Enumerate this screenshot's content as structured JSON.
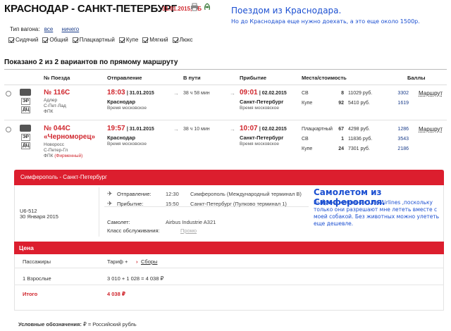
{
  "header": {
    "route_title": "КРАСНОДАР - САНКТ-ПЕТЕРБУРГ",
    "date_label": "31.01.2015, СБ",
    "icons": [
      "print-icon",
      "vk-icon"
    ]
  },
  "annotation1": {
    "title": "Поездом из Краснодара.",
    "subtitle": "Но до Краснодара еще нужно доехать, а это еще около 1500р."
  },
  "filters": {
    "wagon_type_label": "Тип вагона:",
    "all_link": "все",
    "none_link": "ничего",
    "options": [
      "Сидячий",
      "Общий",
      "Плацкартный",
      "Купе",
      "Мягкий",
      "Люкс"
    ]
  },
  "results": {
    "shown_text": "Показано 2 из 2 вариантов по прямому маршруту",
    "columns": [
      "№ Поезда",
      "Отправление",
      "В пути",
      "Прибытие",
      "Места/стоимость",
      "Баллы"
    ],
    "trains": [
      {
        "tag1": "ЭР",
        "tag2": "ДЦ",
        "number": "№ 116С",
        "name": "",
        "route1": "Адлер",
        "route2": "С-Пет-Лад",
        "carrier": "ФПК",
        "carrier_extra": "",
        "dep_time": "18:03",
        "dep_date": "| 31.01.2015",
        "dep_city": "Краснодар",
        "dep_tz": "Время московское",
        "duration": "38 ч 58 мин",
        "arr_time": "09:01",
        "arr_date": "| 02.02.2015",
        "arr_city": "Санкт-Петербург",
        "arr_tz": "Время московское",
        "seats": [
          {
            "class": "СВ",
            "count": "8",
            "price": "11029 руб.",
            "points": "3302"
          },
          {
            "class": "Купе",
            "count": "92",
            "price": "5410 руб.",
            "points": "1619"
          }
        ],
        "route_link": "Маршрут"
      },
      {
        "tag1": "ЭР",
        "tag2": "ДЦ",
        "number": "№ 044С",
        "name": "«Черноморец»",
        "route1": "Новоросс",
        "route2": "С-Петер-Гл",
        "carrier": "ФПК",
        "carrier_extra": "(Фирменный)",
        "dep_time": "19:57",
        "dep_date": "| 31.01.2015",
        "dep_city": "Краснодар",
        "dep_tz": "Время московское",
        "duration": "38 ч 10 мин",
        "arr_time": "10:07",
        "arr_date": "| 02.02.2015",
        "arr_city": "Санкт-Петербург",
        "arr_tz": "Время московское",
        "seats": [
          {
            "class": "Плацкартный",
            "count": "67",
            "price": "4298 руб.",
            "points": "1286"
          },
          {
            "class": "СВ",
            "count": "1",
            "price": "11836 руб.",
            "points": "3543"
          },
          {
            "class": "Купе",
            "count": "24",
            "price": "7301 руб.",
            "points": "2186"
          }
        ],
        "route_link": "Маршрут"
      }
    ]
  },
  "flight": {
    "header": "Симферополь - Санкт-Петербург",
    "code": "U6-512",
    "date": "30 Января 2015",
    "departure_label": "Отправление:",
    "departure_time": "12:30",
    "departure_place": "Симферополь (Международный терминал B)",
    "arrival_label": "Прибытие:",
    "arrival_time": "15:50",
    "arrival_place": "Санкт-Петербург (Пулково терминал 1)",
    "plane_label": "Самолет:",
    "plane_value": "Airbus Industrie A321",
    "class_label": "Класс обслуживания:",
    "class_link": "Промо"
  },
  "annotation2": {
    "title": "Самолетом из Симферополя.",
    "body": "Выбрана компания Ural Airlines ,поскольку только они разрешают мне лететь вместе с моей собакой. Без животных можно улететь еще дешевле."
  },
  "price": {
    "header": "Цена",
    "col_passengers": "Пассажиры",
    "col_tariff": "Тариф +",
    "fees_link": "Сборы",
    "row_label": "1 Взрослые",
    "row_value": "3 010 + 1 028 = 4 038 ₽",
    "total_label": "Итого",
    "total_value": "4 038 ₽"
  },
  "legend": {
    "label": "Условные обозначения:",
    "value": "₽ = Российский рубль"
  }
}
